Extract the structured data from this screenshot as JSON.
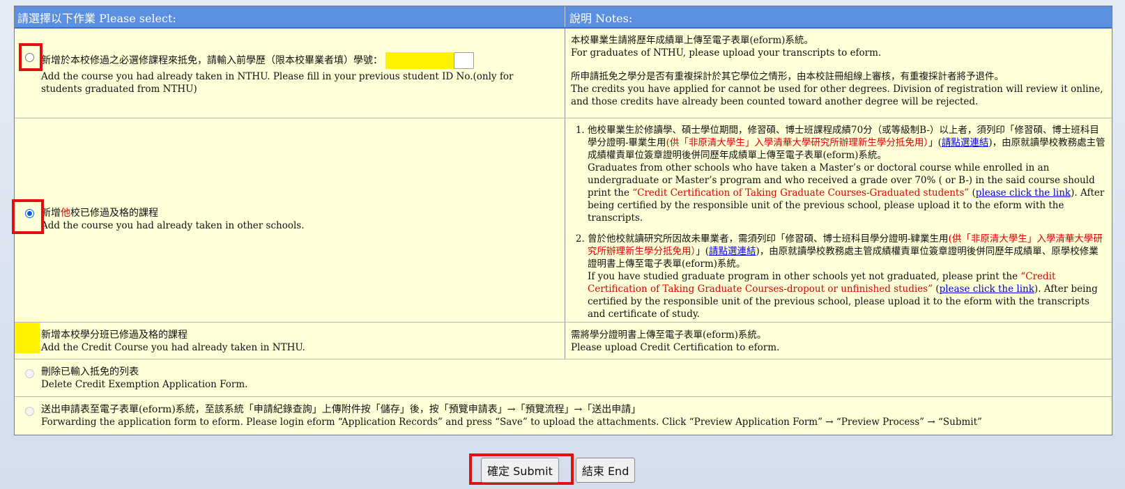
{
  "header": {
    "col_left": "請選擇以下作業 Please select:",
    "col_right": "說明 Notes:"
  },
  "row1": {
    "zh": "新增於本校修過之必選修課程來抵免，請輸入前學歷（限本校畢業者填）學號：",
    "en": "Add the course you had already taken in NTHU. Please fill in your previous student ID No.(only for students graduated from NTHU)",
    "notes": {
      "p1_zh": "本校畢業生請將歷年成績單上傳至電子表單(eform)系統。",
      "p1_en": "For graduates of NTHU, please upload your transcripts to eform.",
      "p2_zh": "所申請抵免之學分是否有重複採計於其它學位之情形，由本校註冊組線上審核，有重複採計者將予退件。",
      "p2_en": "The credits you have applied for cannot be used for other degrees. Division of registration will review it online, and those credits have already been counted toward another degree will be rejected."
    }
  },
  "row2": {
    "zh_a": "新增",
    "zh_red": "他",
    "zh_b": "校已修過及格的課程",
    "en": "Add the course you had already taken in other schools.",
    "notes": {
      "item1_zh_a": "他校畢業生於修讀學、碩士學位期間，修習碩、博士班課程成績70分（或等級制B-）以上者，須列印「修習碩、博士班科目學分證明-畢業生用",
      "item1_zh_red": "(供「非原清大學生」入學清華大學研究所辦理新生學分抵免用）",
      "item1_zh_b": "」(",
      "item1_link": "請點選連結",
      "item1_zh_c": ")，由原就讀學校教務處主管成績權責單位簽章證明後併同歷年成績單上傳至電子表單(eform)系統。",
      "item1_en_a": "Graduates from other schools who have taken a Master’s or doctoral course while enrolled in an undergraduate or Master’s program and who received a grade over 70% ( or B-) in the said course should print the",
      "item1_en_red": "“Credit Certification of Taking Graduate Courses-Graduated students”",
      "item1_en_b": "(",
      "item1_en_link": "please click the link",
      "item1_en_c": "). After being certified by the responsible unit of the previous school, please upload it to the eform with the transcripts.",
      "item2_zh_a": "曾於他校就讀研究所因故未畢業者，需須列印「修習碩、博士班科目學分證明-肄業生用",
      "item2_zh_red": "(供「非原清大學生」入學清華大學研究所辦理新生學分抵免用）",
      "item2_zh_b": "」(",
      "item2_link": "請點選連結",
      "item2_zh_c": ")，由原就讀學校教務處主管成績權責單位簽章證明後併同歷年成績單、原學校修業證明書上傳至電子表單(eform)系統。",
      "item2_en_a": "If you have studied graduate program in other schools yet not graduated, please print the",
      "item2_en_red": "“Credit Certification of Taking Graduate Courses-dropout or unfinished studies”",
      "item2_en_b": "(",
      "item2_en_link": "please click the link",
      "item2_en_c": "). After being certified by the responsible unit of the previous school, please upload it to the eform with the transcripts and certificate of study."
    }
  },
  "row3": {
    "zh": "新增本校學分班已修過及格的課程",
    "en": "Add the Credit Course you had already taken in NTHU.",
    "notes": {
      "zh": "需將學分證明書上傳至電子表單(eform)系統。",
      "en": "Please upload Credit Certification to eform."
    }
  },
  "row4": {
    "zh": "刪除已輸入抵免的列表",
    "en": "Delete Credit Exemption Application Form."
  },
  "row5": {
    "zh": "送出申請表至電子表單(eform)系統，至該系統「申請紀錄查詢」上傳附件按「儲存」後，按「預覽申請表」→「預覽流程」→「送出申請」",
    "en": "Forwarding the application form to eform. Please login eform “Application Records” and press “Save” to upload the attachments. Click “Preview Application Form” → “Preview Process” → “Submit”"
  },
  "buttons": {
    "submit": "確定 Submit",
    "end": "結束 End"
  },
  "colors": {
    "header_bg": "#5b8fe0",
    "row_bg": "#ffffd8",
    "highlight": "#e01010",
    "id_field": "#fff200",
    "note_red": "#d90000",
    "link": "#0000dd"
  }
}
